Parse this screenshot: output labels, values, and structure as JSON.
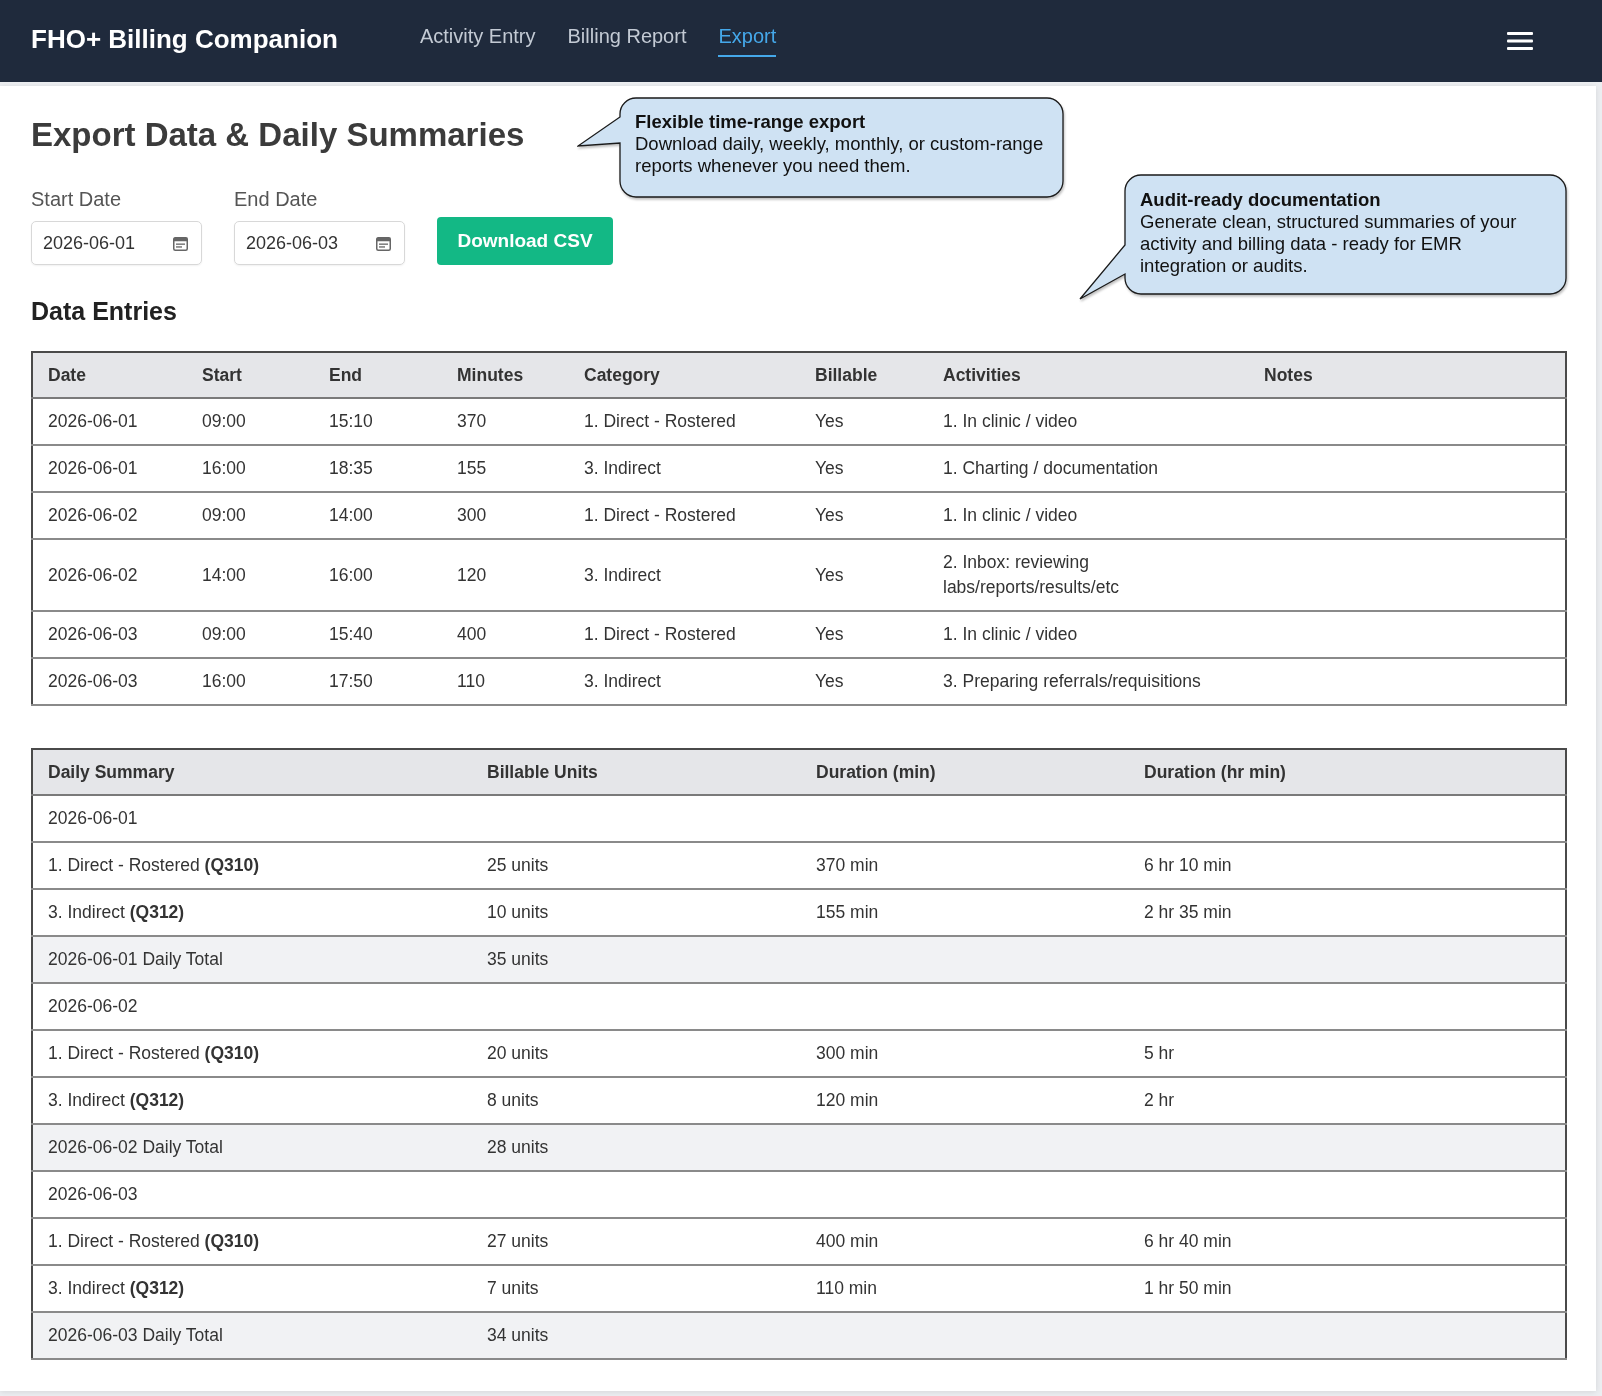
{
  "app": {
    "title": "FHO+ Billing Companion",
    "nav": [
      {
        "label": "Activity Entry",
        "selected": false
      },
      {
        "label": "Billing Report",
        "selected": false
      },
      {
        "label": "Export",
        "selected": true
      }
    ]
  },
  "page": {
    "title": "Export Data & Daily Summaries"
  },
  "callouts": [
    {
      "title": "Flexible time-range export",
      "text": "Download daily, weekly, monthly, or custom-range reports whenever you need them."
    },
    {
      "title": "Audit-ready documentation",
      "text": "Generate clean, structured summaries of your activity and billing data - ready for EMR integration or audits."
    }
  ],
  "export_form": {
    "fields": [
      {
        "label": "Start Date",
        "value": "2026-06-01"
      },
      {
        "label": "End Date",
        "value": "2026-06-03"
      }
    ],
    "button": "Download CSV"
  },
  "data_entries": {
    "title": "Data Entries",
    "columns": [
      "Date",
      "Start",
      "End",
      "Minutes",
      "Category",
      "Billable",
      "Activities",
      "Notes"
    ],
    "rows": [
      [
        "2026-06-01",
        "09:00",
        "15:10",
        "370",
        "1. Direct - Rostered",
        "Yes",
        "1. In clinic / video"
      ],
      [
        "2026-06-01",
        "16:00",
        "18:35",
        "155",
        "3. Indirect",
        "Yes",
        "1. Charting / documentation"
      ],
      [
        "2026-06-02",
        "09:00",
        "14:00",
        "300",
        "1. Direct - Rostered",
        "Yes",
        "1. In clinic / video"
      ],
      [
        "2026-06-02",
        "14:00",
        "16:00",
        "120",
        "3. Indirect",
        "Yes",
        "2. Inbox: reviewing labs/reports/results/etc"
      ],
      [
        "2026-06-03",
        "09:00",
        "15:40",
        "400",
        "1. Direct - Rostered",
        "Yes",
        "1. In clinic / video"
      ],
      [
        "2026-06-03",
        "16:00",
        "17:50",
        "110",
        "3. Indirect",
        "Yes",
        "3. Preparing referrals/requisitions"
      ]
    ]
  },
  "daily_summary": {
    "columns": [
      "Daily Summary",
      "Billable Units",
      "Duration (min)",
      "Duration (hr min)"
    ],
    "rows": [
      {
        "kind": "date",
        "cells": [
          "2026-06-01"
        ]
      },
      {
        "kind": "item",
        "cells": [
          "1. Direct - Rostered **(Q310)**",
          "25 units",
          "370 min",
          "6 hr 10 min"
        ]
      },
      {
        "kind": "item",
        "cells": [
          "3. Indirect **(Q312)**",
          "10 units",
          "155 min",
          "2 hr 35 min"
        ]
      },
      {
        "kind": "total",
        "cells": [
          "2026-06-01 Daily Total",
          "35 units"
        ]
      },
      {
        "kind": "date",
        "cells": [
          "2026-06-02"
        ]
      },
      {
        "kind": "item",
        "cells": [
          "1. Direct - Rostered **(Q310)**",
          "20 units",
          "300 min",
          "5 hr"
        ]
      },
      {
        "kind": "item",
        "cells": [
          "3. Indirect **(Q312)**",
          "8 units",
          "120 min",
          "2 hr"
        ]
      },
      {
        "kind": "total",
        "cells": [
          "2026-06-02 Daily Total",
          "28 units"
        ]
      },
      {
        "kind": "date",
        "cells": [
          "2026-06-03"
        ]
      },
      {
        "kind": "item",
        "cells": [
          "1. Direct - Rostered **(Q310)**",
          "27 units",
          "400 min",
          "6 hr 40 min"
        ]
      },
      {
        "kind": "item",
        "cells": [
          "3. Indirect **(Q312)**",
          "7 units",
          "110 min",
          "1 hr 50 min"
        ]
      },
      {
        "kind": "total",
        "cells": [
          "2026-06-03 Daily Total",
          "34 units"
        ]
      }
    ]
  }
}
